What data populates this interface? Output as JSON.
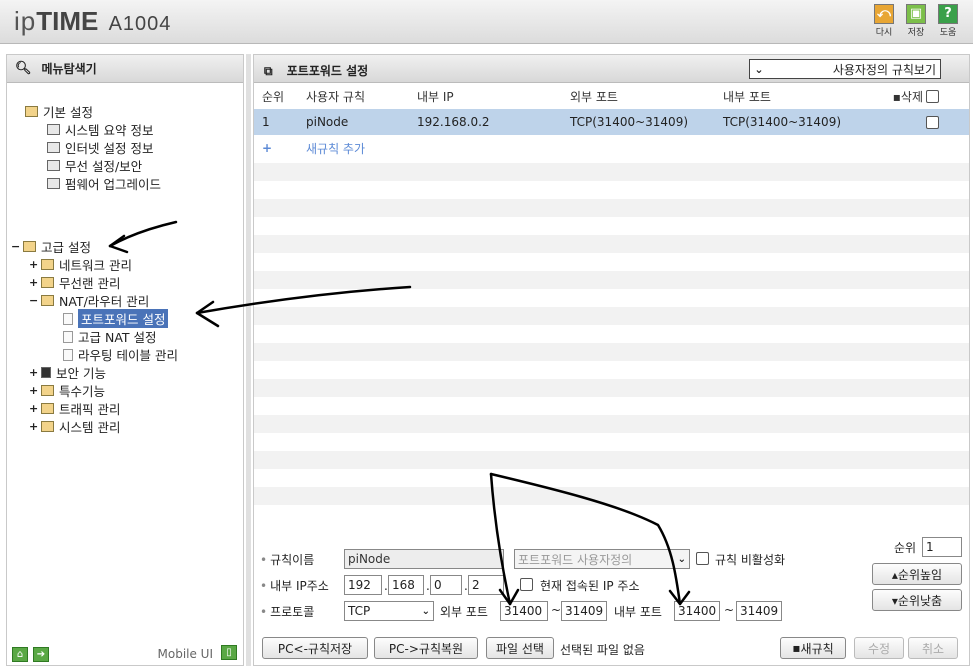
{
  "header": {
    "brand_prefix": "ip",
    "brand_bold": "TIME",
    "model": "A1004",
    "buttons": [
      {
        "label": "다시",
        "glyph": "⤺"
      },
      {
        "label": "저장",
        "glyph": "▣"
      },
      {
        "label": "도움",
        "glyph": "?"
      }
    ]
  },
  "sidebar": {
    "title": "메뉴탐색기",
    "basic": {
      "label": "기본 설정",
      "items": [
        "시스템 요약 정보",
        "인터넷 설정 정보",
        "무선 설정/보안",
        "펌웨어 업그레이드"
      ]
    },
    "advanced": {
      "label": "고급 설정",
      "network": "네트워크 관리",
      "wireless": "무선랜 관리",
      "nat": "NAT/라우터 관리",
      "nat_items": [
        "포트포워드 설정",
        "고급 NAT 설정",
        "라우팅 테이블 관리"
      ],
      "security": "보안 기능",
      "special": "특수기능",
      "traffic": "트래픽 관리",
      "system": "시스템 관리"
    },
    "footer": {
      "mobile": "Mobile UI"
    }
  },
  "main": {
    "title": "포트포워드 설정",
    "view_select": "사용자정의 규칙보기",
    "columns": [
      "순위",
      "사용자 규칙",
      "내부 IP",
      "외부 포트",
      "내부 포트",
      "삭제"
    ],
    "rows": [
      {
        "rank": "1",
        "name": "piNode",
        "ip": "192.168.0.2",
        "ext": "TCP(31400~31409)",
        "int": "TCP(31400~31409)"
      }
    ],
    "add_rule": "새규칙 추가",
    "add_glyph": "+"
  },
  "form": {
    "rule_name_label": "규칙이름",
    "rule_name_value": "piNode",
    "preset_placeholder": "포트포워드 사용자정의",
    "disable_label": "규칙 비활성화",
    "ip_label": "내부 IP주소",
    "ip": [
      "192",
      "168",
      "0",
      "2"
    ],
    "current_ip_label": "현재 접속된 IP 주소",
    "protocol_label": "프로토콜",
    "protocol": "TCP",
    "ext_port_label": "외부 포트",
    "ext_from": "31400",
    "ext_to": "31409",
    "int_port_label": "내부 포트",
    "int_from": "31400",
    "int_to": "31409",
    "tilde": "~",
    "rank_label": "순위",
    "rank_value": "1",
    "rank_up": "▴순위높임",
    "rank_down": "▾순위낮춤"
  },
  "bottom": {
    "save_to_pc": "PC<-규칙저장",
    "restore_from_pc": "PC->규칙복원",
    "file_select": "파일 선택",
    "no_file": "선택된 파일 없음",
    "new_rule": "새규칙",
    "modify": "수정",
    "cancel": "취소"
  }
}
